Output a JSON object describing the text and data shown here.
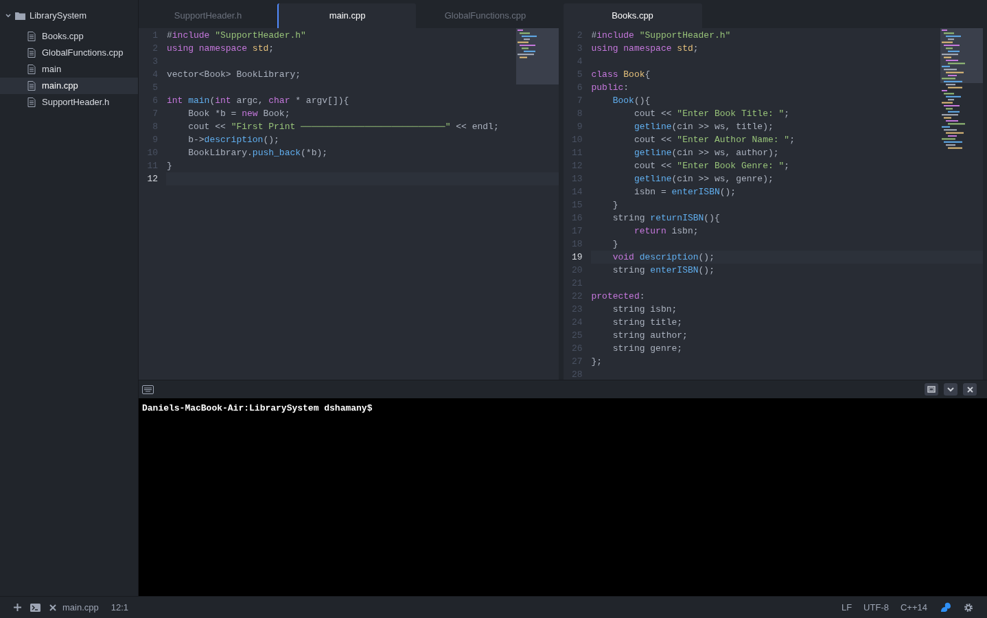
{
  "tree": {
    "label": "LibrarySystem",
    "expanded": true,
    "children": [
      {
        "label": "Books.cpp",
        "selected": false
      },
      {
        "label": "GlobalFunctions.cpp",
        "selected": false
      },
      {
        "label": "main",
        "selected": false
      },
      {
        "label": "main.cpp",
        "selected": true
      },
      {
        "label": "SupportHeader.h",
        "selected": false
      }
    ]
  },
  "panes": [
    {
      "tabs": [
        {
          "label": "SupportHeader.h",
          "selected": false
        },
        {
          "label": "main.cpp",
          "selected": true
        },
        {
          "label": "GlobalFunctions.cpp",
          "selected": false
        }
      ],
      "lines": [
        {
          "number": "1",
          "current": false,
          "tokens": [
            {
              "kind": "plain",
              "text": "#"
            },
            {
              "kind": "keyword",
              "text": "include"
            },
            {
              "kind": "string",
              "text": " \"SupportHeader.h\""
            }
          ]
        },
        {
          "number": "2",
          "current": false,
          "tokens": [
            {
              "kind": "keyword",
              "text": "using namespace"
            },
            {
              "kind": "type",
              "text": " std"
            },
            {
              "kind": "plain",
              "text": ";"
            }
          ]
        },
        {
          "number": "3",
          "current": false
        },
        {
          "number": "4",
          "current": false,
          "tokens": [
            {
              "kind": "plain",
              "text": "vector<Book> BookLibrary;"
            }
          ]
        },
        {
          "number": "5",
          "current": false
        },
        {
          "number": "6",
          "current": false,
          "tokens": [
            {
              "kind": "keyword",
              "text": "int"
            },
            {
              "kind": "function",
              "text": " main"
            },
            {
              "kind": "plain",
              "text": "("
            },
            {
              "kind": "keyword",
              "text": "int"
            },
            {
              "kind": "plain",
              "text": " argc, "
            },
            {
              "kind": "keyword",
              "text": "char"
            },
            {
              "kind": "plain",
              "text": " * argv[]){"
            }
          ]
        },
        {
          "number": "7",
          "current": false,
          "tokens": [
            {
              "kind": "plain",
              "text": "    Book *b = "
            },
            {
              "kind": "keyword",
              "text": "new"
            },
            {
              "kind": "plain",
              "text": " Book;"
            }
          ]
        },
        {
          "number": "8",
          "current": false,
          "tokens": [
            {
              "kind": "plain",
              "text": "    cout << "
            },
            {
              "kind": "string",
              "text": "\"First Print ───────────────────────────\""
            },
            {
              "kind": "plain",
              "text": " << endl;"
            }
          ]
        },
        {
          "number": "9",
          "current": false,
          "tokens": [
            {
              "kind": "plain",
              "text": "    b->"
            },
            {
              "kind": "function",
              "text": "description"
            },
            {
              "kind": "plain",
              "text": "();"
            }
          ]
        },
        {
          "number": "10",
          "current": false,
          "tokens": [
            {
              "kind": "plain",
              "text": "    BookLibrary."
            },
            {
              "kind": "function",
              "text": "push_back"
            },
            {
              "kind": "plain",
              "text": "(*b);"
            }
          ]
        },
        {
          "number": "11",
          "current": false,
          "tokens": [
            {
              "kind": "plain",
              "text": "}"
            }
          ]
        },
        {
          "number": "12",
          "current": true
        }
      ]
    },
    {
      "tabs": [
        {
          "label": "Books.cpp",
          "selected": true
        }
      ],
      "lines": [
        {
          "number": "2",
          "current": false,
          "tokens": [
            {
              "kind": "plain",
              "text": "#"
            },
            {
              "kind": "keyword",
              "text": "include"
            },
            {
              "kind": "string",
              "text": " \"SupportHeader.h\""
            }
          ]
        },
        {
          "number": "3",
          "current": false,
          "tokens": [
            {
              "kind": "keyword",
              "text": "using namespace"
            },
            {
              "kind": "type",
              "text": " std"
            },
            {
              "kind": "plain",
              "text": ";"
            }
          ]
        },
        {
          "number": "4",
          "current": false
        },
        {
          "number": "5",
          "current": false,
          "tokens": [
            {
              "kind": "keyword",
              "text": "class"
            },
            {
              "kind": "type",
              "text": " Book"
            },
            {
              "kind": "plain",
              "text": "{"
            }
          ]
        },
        {
          "number": "6",
          "current": false,
          "tokens": [
            {
              "kind": "keyword",
              "text": "public"
            },
            {
              "kind": "plain",
              "text": ":"
            }
          ]
        },
        {
          "number": "7",
          "current": false,
          "tokens": [
            {
              "kind": "function",
              "text": "    Book"
            },
            {
              "kind": "plain",
              "text": "(){"
            }
          ]
        },
        {
          "number": "8",
          "current": false,
          "tokens": [
            {
              "kind": "plain",
              "text": "        cout << "
            },
            {
              "kind": "string",
              "text": "\"Enter Book Title: \""
            },
            {
              "kind": "plain",
              "text": ";"
            }
          ]
        },
        {
          "number": "9",
          "current": false,
          "tokens": [
            {
              "kind": "function",
              "text": "        getline"
            },
            {
              "kind": "plain",
              "text": "(cin >> ws, title);"
            }
          ]
        },
        {
          "number": "10",
          "current": false,
          "tokens": [
            {
              "kind": "plain",
              "text": "        cout << "
            },
            {
              "kind": "string",
              "text": "\"Enter Author Name: \""
            },
            {
              "kind": "plain",
              "text": ";"
            }
          ]
        },
        {
          "number": "11",
          "current": false,
          "tokens": [
            {
              "kind": "function",
              "text": "        getline"
            },
            {
              "kind": "plain",
              "text": "(cin >> ws, author);"
            }
          ]
        },
        {
          "number": "12",
          "current": false,
          "tokens": [
            {
              "kind": "plain",
              "text": "        cout << "
            },
            {
              "kind": "string",
              "text": "\"Enter Book Genre: \""
            },
            {
              "kind": "plain",
              "text": ";"
            }
          ]
        },
        {
          "number": "13",
          "current": false,
          "tokens": [
            {
              "kind": "function",
              "text": "        getline"
            },
            {
              "kind": "plain",
              "text": "(cin >> ws, genre);"
            }
          ]
        },
        {
          "number": "14",
          "current": false,
          "tokens": [
            {
              "kind": "plain",
              "text": "        isbn = "
            },
            {
              "kind": "function",
              "text": "enterISBN"
            },
            {
              "kind": "plain",
              "text": "();"
            }
          ]
        },
        {
          "number": "15",
          "current": false,
          "tokens": [
            {
              "kind": "plain",
              "text": "    }"
            }
          ]
        },
        {
          "number": "16",
          "current": false,
          "tokens": [
            {
              "kind": "plain",
              "text": "    string "
            },
            {
              "kind": "function",
              "text": "returnISBN"
            },
            {
              "kind": "plain",
              "text": "(){"
            }
          ]
        },
        {
          "number": "17",
          "current": false,
          "tokens": [
            {
              "kind": "keyword",
              "text": "        return"
            },
            {
              "kind": "plain",
              "text": " isbn;"
            }
          ]
        },
        {
          "number": "18",
          "current": false,
          "tokens": [
            {
              "kind": "plain",
              "text": "    }"
            }
          ]
        },
        {
          "number": "19",
          "current": true,
          "tokens": [
            {
              "kind": "keyword",
              "text": "    void"
            },
            {
              "kind": "function",
              "text": " description"
            },
            {
              "kind": "plain",
              "text": "();"
            }
          ]
        },
        {
          "number": "20",
          "current": false,
          "tokens": [
            {
              "kind": "plain",
              "text": "    string "
            },
            {
              "kind": "function",
              "text": "enterISBN"
            },
            {
              "kind": "plain",
              "text": "();"
            }
          ]
        },
        {
          "number": "21",
          "current": false
        },
        {
          "number": "22",
          "current": false,
          "tokens": [
            {
              "kind": "keyword",
              "text": "protected"
            },
            {
              "kind": "plain",
              "text": ":"
            }
          ]
        },
        {
          "number": "23",
          "current": false,
          "tokens": [
            {
              "kind": "plain",
              "text": "    string isbn;"
            }
          ]
        },
        {
          "number": "24",
          "current": false,
          "tokens": [
            {
              "kind": "plain",
              "text": "    string title;"
            }
          ]
        },
        {
          "number": "25",
          "current": false,
          "tokens": [
            {
              "kind": "plain",
              "text": "    string author;"
            }
          ]
        },
        {
          "number": "26",
          "current": false,
          "tokens": [
            {
              "kind": "plain",
              "text": "    string genre;"
            }
          ]
        },
        {
          "number": "27",
          "current": false,
          "tokens": [
            {
              "kind": "plain",
              "text": "};"
            }
          ]
        },
        {
          "number": "28",
          "current": false
        }
      ]
    }
  ],
  "terminal": {
    "prompt": "Daniels-MacBook-Air:LibrarySystem dshamany$"
  },
  "status_bar": {
    "file": "main.cpp",
    "cursor": "12:1",
    "line_ending": "LF",
    "encoding": "UTF-8",
    "grammar": "C++14"
  }
}
